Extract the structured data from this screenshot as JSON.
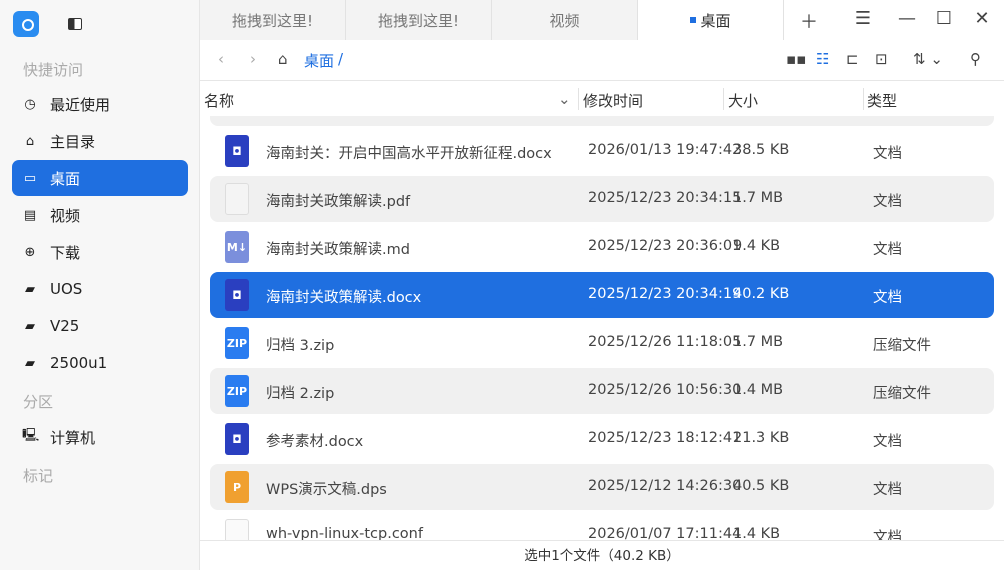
{
  "sidebar": {
    "sections": {
      "quick": "快捷访问",
      "partitions": "分区",
      "tags": "标记"
    },
    "items": [
      {
        "label": "最近使用",
        "icon": "clock-icon"
      },
      {
        "label": "主目录",
        "icon": "home-icon"
      },
      {
        "label": "桌面",
        "icon": "desktop-icon"
      },
      {
        "label": "视频",
        "icon": "video-icon"
      },
      {
        "label": "下载",
        "icon": "download-icon"
      },
      {
        "label": "UOS",
        "icon": "folder-icon"
      },
      {
        "label": "V25",
        "icon": "folder-icon"
      },
      {
        "label": "2500u1",
        "icon": "folder-icon"
      }
    ],
    "computer": "计算机"
  },
  "tabs": [
    {
      "label": "拖拽到这里!"
    },
    {
      "label": "拖拽到这里!"
    },
    {
      "label": "视频"
    },
    {
      "label": "桌面"
    }
  ],
  "breadcrumb": {
    "current": "桌面",
    "sep": "/"
  },
  "columns": {
    "name": "名称",
    "modified": "修改时间",
    "size": "大小",
    "type": "类型"
  },
  "files": [
    {
      "name": "海南封关：开启中国高水平开放新征程.docx",
      "modified": "2026/01/13 19:47:42",
      "size": "38.5 KB",
      "type": "文档",
      "kind": "docx"
    },
    {
      "name": "海南封关政策解读.pdf",
      "modified": "2025/12/23 20:34:15",
      "size": "1.7 MB",
      "type": "文档",
      "kind": "pdf"
    },
    {
      "name": "海南封关政策解读.md",
      "modified": "2025/12/23 20:36:01",
      "size": "9.4 KB",
      "type": "文档",
      "kind": "md"
    },
    {
      "name": "海南封关政策解读.docx",
      "modified": "2025/12/23 20:34:19",
      "size": "40.2 KB",
      "type": "文档",
      "kind": "docx"
    },
    {
      "name": "归档 3.zip",
      "modified": "2025/12/26 11:18:05",
      "size": "1.7 MB",
      "type": "压缩文件",
      "kind": "zip"
    },
    {
      "name": "归档 2.zip",
      "modified": "2025/12/26 10:56:30",
      "size": "1.4 MB",
      "type": "压缩文件",
      "kind": "zip"
    },
    {
      "name": "参考素材.docx",
      "modified": "2025/12/23 18:12:41",
      "size": "21.3 KB",
      "type": "文档",
      "kind": "docx"
    },
    {
      "name": "WPS演示文稿.dps",
      "modified": "2025/12/12 14:26:30",
      "size": "40.5 KB",
      "type": "文档",
      "kind": "dps"
    },
    {
      "name": "wh-vpn-linux-tcp.conf",
      "modified": "2026/01/07 17:11:44",
      "size": "1.4 KB",
      "type": "文档",
      "kind": "conf"
    }
  ],
  "selected_index": 3,
  "status": "选中1个文件（40.2 KB）",
  "colors": {
    "accent": "#1f6fe0"
  }
}
